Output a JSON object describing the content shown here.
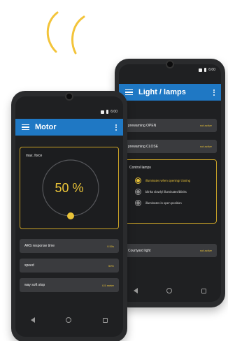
{
  "colors": {
    "accent": "#e9c338",
    "appbar": "#1f78c4",
    "screen": "#1f2022",
    "row": "#3a3b3e"
  },
  "back_phone": {
    "status_time": "6:00",
    "title": "Light / lamps",
    "rows": [
      {
        "label": "prewarning OPEN",
        "value": "not active"
      },
      {
        "label": "prewarning CLOSE",
        "value": "not active"
      }
    ],
    "control_lamps": {
      "heading": "Control lamps",
      "options": [
        {
          "label": "illuminates when opening/ closing",
          "selected": true
        },
        {
          "label": "blinks slowly/ illuminates/blinks",
          "selected": false
        },
        {
          "label": "illuminates in open position",
          "selected": false
        }
      ]
    },
    "courtyard": {
      "label": "Courtyard light",
      "value": "not active"
    }
  },
  "front_phone": {
    "status_time": "6:00",
    "title": "Motor",
    "force_card": {
      "label": "max. force",
      "value": "50 %",
      "level": 0.5
    },
    "rows": [
      {
        "label": "ARS response time",
        "value": "0.50s"
      },
      {
        "label": "speed",
        "value": "50%"
      },
      {
        "label": "way soft stop",
        "value": "0.5 meter"
      }
    ]
  }
}
